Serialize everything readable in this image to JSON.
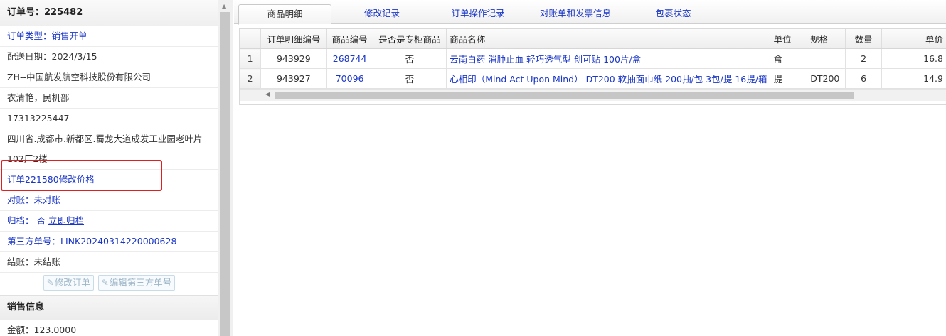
{
  "order": {
    "title": "订单号：225482",
    "type_label": "订单类型：",
    "type_value": "销售开单",
    "delivery_date": "配送日期：2024/3/15",
    "company": "ZH--中国航发航空科技股份有限公司",
    "contact": "衣清艳，民机部",
    "phone": "17313225447",
    "address": "四川省.成都市.新都区.蜀龙大道成发工业园老叶片102厂2楼",
    "modify_note": "订单221580修改价格",
    "reconcile_label": "对账：",
    "reconcile_value": "未对账",
    "archive_label": "归档：",
    "archive_value": "否",
    "archive_link": "立即归档",
    "third_party_label": "第三方单号：",
    "third_party_value": "LINK20240314220000628",
    "settle": "结账：未结账",
    "edit_order_btn": "修改订单",
    "edit_third_btn": "编辑第三方单号"
  },
  "sales": {
    "header": "销售信息",
    "amount": "金额：123.0000"
  },
  "tabs": [
    {
      "label": "商品明细",
      "active": true
    },
    {
      "label": "修改记录",
      "active": false
    },
    {
      "label": "订单操作记录",
      "active": false
    },
    {
      "label": "对账单和发票信息",
      "active": false
    },
    {
      "label": "包裹状态",
      "active": false
    }
  ],
  "grid": {
    "columns": [
      "",
      "订单明细编号",
      "商品编号",
      "是否是专柜商品",
      "商品名称",
      "单位",
      "规格",
      "数量",
      "单价"
    ],
    "rows": [
      [
        "1",
        "943929",
        "268744",
        "否",
        "云南白药 消肿止血 轻巧透气型 创可贴 100片/盒",
        "盒",
        "",
        "2",
        "16.8"
      ],
      [
        "2",
        "943927",
        "70096",
        "否",
        "心相印（Mind Act Upon Mind） DT200 软抽面巾纸 200抽/包 3包/提 16提/箱",
        "提",
        "DT200",
        "6",
        "14.9"
      ]
    ]
  },
  "colors": {
    "link": "#1a36c6",
    "annotation": "#e02020"
  }
}
